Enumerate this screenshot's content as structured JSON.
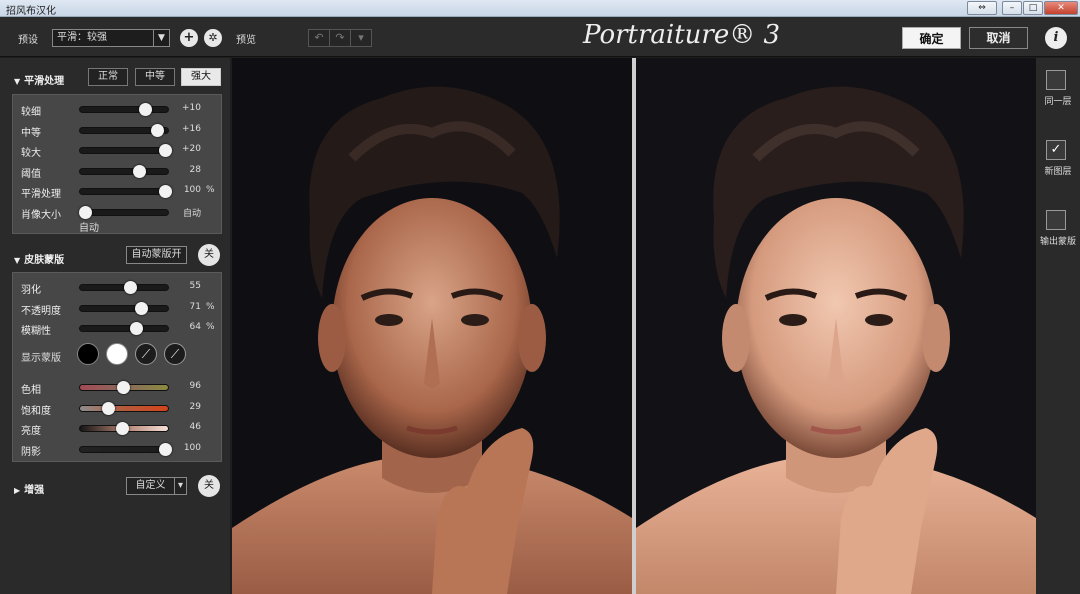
{
  "window": {
    "title": "招风布汉化"
  },
  "toolbar": {
    "preset_label": "预设",
    "preset_value": "平滑：较强",
    "add_symbol": "+",
    "settings_symbol": "✲",
    "preview_label": "预览",
    "undo_symbol": "↶",
    "redo_symbol": "↷",
    "history_symbol": "▾",
    "logo": "Portraiture® 3",
    "ok_label": "确定",
    "cancel_label": "取消",
    "info_symbol": "i"
  },
  "smoothing": {
    "title": "平滑处理",
    "modes": [
      {
        "label": "正常",
        "active": false
      },
      {
        "label": "中等",
        "active": false
      },
      {
        "label": "强大",
        "active": true
      }
    ],
    "sliders": [
      {
        "label": "较细",
        "value": "+10",
        "unit": "",
        "fraction": 0.72
      },
      {
        "label": "中等",
        "value": "+16",
        "unit": "",
        "fraction": 0.85
      },
      {
        "label": "较大",
        "value": "+20",
        "unit": "",
        "fraction": 0.94
      },
      {
        "label": "阈值",
        "value": "28",
        "unit": "",
        "fraction": 0.66
      },
      {
        "label": "平滑处理",
        "value": "100",
        "unit": "%",
        "fraction": 0.94
      },
      {
        "label": "肖像大小",
        "value": "自动",
        "unit": "",
        "fraction": 0.05
      }
    ],
    "portrait_size_sub": "自动"
  },
  "skin_mask": {
    "title": "皮肤蒙版",
    "auto_mask_label": "自动蒙版开",
    "off_label": "关",
    "sliders": [
      {
        "label": "羽化",
        "value": "55",
        "unit": "",
        "fraction": 0.55
      },
      {
        "label": "不透明度",
        "value": "71",
        "unit": "%",
        "fraction": 0.68
      },
      {
        "label": "模糊性",
        "value": "64",
        "unit": "%",
        "fraction": 0.62
      }
    ],
    "show_mask_label": "显示蒙版",
    "color_sliders": [
      {
        "label": "色相",
        "value": "96",
        "fraction": 0.48
      },
      {
        "label": "饱和度",
        "value": "29",
        "fraction": 0.31
      },
      {
        "label": "亮度",
        "value": "46",
        "fraction": 0.47
      },
      {
        "label": "阴影",
        "value": "100",
        "fraction": 0.94
      }
    ]
  },
  "enhance": {
    "title": "增强",
    "custom_label": "自定义",
    "dropdown_symbol": "▾",
    "off_label": "关"
  },
  "output": {
    "options": [
      {
        "label": "同一层",
        "checked": false
      },
      {
        "label": "新图层",
        "checked": true
      },
      {
        "label": "输出蒙版",
        "checked": false
      }
    ],
    "check_symbol": "✓"
  },
  "colors": {
    "accent_active": "#e9e9e9",
    "panel_bg": "#2a2a2a",
    "group_bg": "#474747",
    "hue_gradient": "linear-gradient(90deg,#a34a55,#8a6a5c,#8b8a40)",
    "sat_gradient": "linear-gradient(90deg,#8d8d8d,#b55a3a,#d4441c)",
    "lum_gradient": "linear-gradient(90deg,#151515,#b08070,#f6e0d6)",
    "shadow_gradient": "linear-gradient(90deg,#222,#1c1c1c)"
  }
}
